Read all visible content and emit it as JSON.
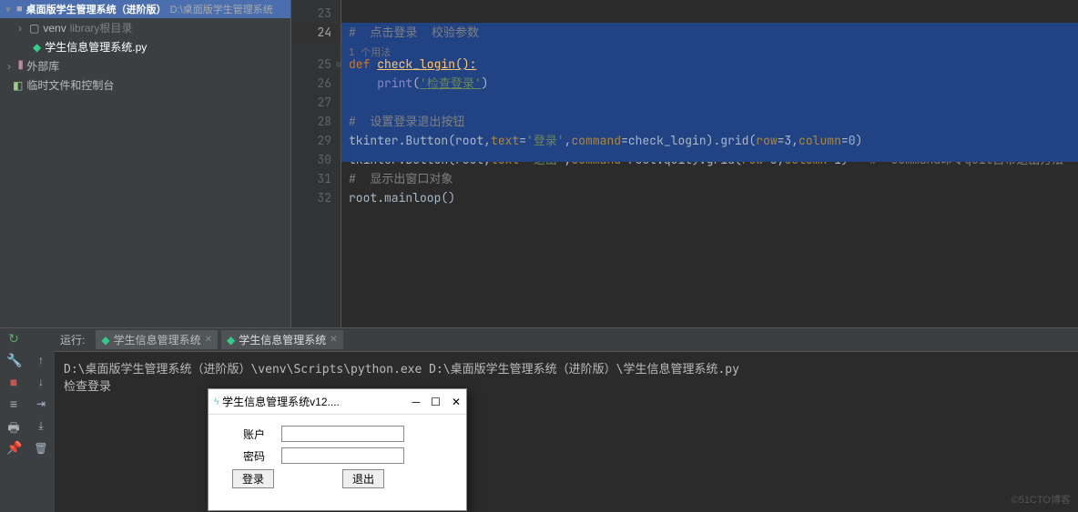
{
  "sidebar": {
    "project_name": "桌面版学生管理系统（进阶版）",
    "project_path": "D:\\桌面版学生管理系统",
    "venv": {
      "name": "venv",
      "hint": "library根目录"
    },
    "file": "学生信息管理系统.py",
    "ext_lib": "外部库",
    "scratch": "临时文件和控制台"
  },
  "gutter": {
    "l23": "23",
    "l24": "24",
    "l25": "25",
    "l26": "26",
    "l27": "27",
    "l28": "28",
    "l29": "29",
    "l30": "30",
    "l31": "31",
    "l32": "32"
  },
  "code": {
    "l24_cmt": "#  点击登录  校验参数",
    "usage": "1 个用法",
    "l25_def": "def ",
    "l25_fn": "check_login():",
    "l26_pre": "    ",
    "l26_print": "print",
    "l26_open": "(",
    "l26_str": "'检查登录'",
    "l26_close": ")",
    "l28_cmt": "#  设置登录退出按钮",
    "l29_a": "tkinter.Button(root,",
    "l29_text": "text",
    "l29_eq1": "=",
    "l29_str": "'登录'",
    "l29_c": ",",
    "l29_cmd": "command",
    "l29_eq2": "=check_login).grid(",
    "l29_row": "row",
    "l29_rv": "=3,",
    "l29_col": "column",
    "l29_cv": "=0)",
    "l30_a": "tkinter.Button(root,",
    "l30_text": "text",
    "l30_eq1": "=",
    "l30_str": "'退出'",
    "l30_c": ",",
    "l30_cmd": "command",
    "l30_eq2": "=root.quit).grid(",
    "l30_row": "row",
    "l30_rv": "=3,",
    "l30_col": "column",
    "l30_cv": "=1)",
    "l30_cmt": "   #  command命令quit自带退出方法",
    "l31_cmt": "#  显示出窗口对象",
    "l32_a": "root.mainloop()"
  },
  "run": {
    "label": "运行:",
    "tab1": "学生信息管理系统",
    "tab2": "学生信息管理系统",
    "line1": "D:\\桌面版学生管理系统（进阶版）\\venv\\Scripts\\python.exe D:\\桌面版学生管理系统（进阶版）\\学生信息管理系统.py",
    "line2": "检查登录"
  },
  "tk": {
    "title": "学生信息管理系统v12....",
    "account": "账户",
    "password": "密码",
    "login": "登录",
    "exit": "退出"
  },
  "watermark": "©51CTO博客"
}
